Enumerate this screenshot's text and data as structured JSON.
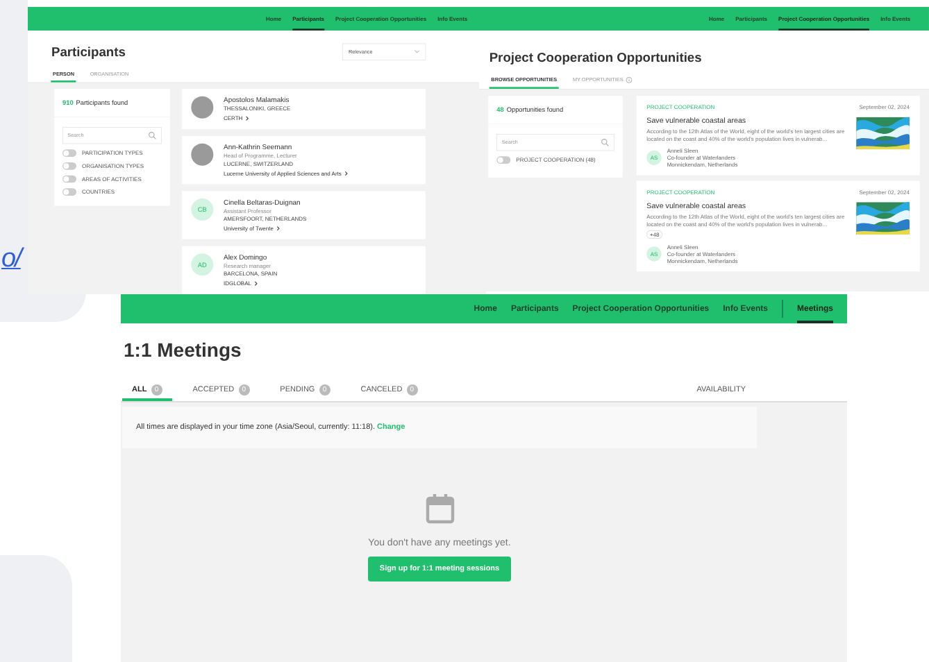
{
  "background_link": "o/",
  "participants_window": {
    "nav": [
      {
        "label": "Home",
        "selected": false
      },
      {
        "label": "Participants",
        "selected": true
      },
      {
        "label": "Project Cooperation Opportunities",
        "selected": false
      },
      {
        "label": "Info Events",
        "selected": false
      }
    ],
    "title": "Participants",
    "sort": "Relevance",
    "tabs": [
      {
        "label": "PERSON",
        "selected": true
      },
      {
        "label": "ORGANISATION",
        "selected": false
      }
    ],
    "found_count": "910",
    "found_label": "Participants found",
    "search": {
      "placeholder": "Search"
    },
    "filters": [
      {
        "label": "PARTICIPATION TYPES",
        "on": false
      },
      {
        "label": "ORGANISATION TYPES",
        "on": false
      },
      {
        "label": "AREAS OF ACTIVITIES",
        "on": false
      },
      {
        "label": "COUNTRIES",
        "on": false
      }
    ],
    "people": [
      {
        "kind": "photo",
        "name": "Apostolos Malamakis",
        "location": "THESSALONIKI, GREECE",
        "organisation": "CERTH"
      },
      {
        "kind": "photo",
        "name": "Ann-Kathrin Seemann",
        "role": "Head of Programme, Lecturer",
        "location": "LUCERNE, SWITZERLAND",
        "organisation": "Lucerne University of Applied Sciences and Arts"
      },
      {
        "kind": "initials",
        "initials": "CB",
        "name": "Cinella Beltaras-Duignan",
        "role": "Assistant Professor",
        "location": "AMERSFOORT, NETHERLANDS",
        "organisation": "University of Twente"
      },
      {
        "kind": "initials",
        "initials": "AD",
        "name": "Alex Domingo",
        "role": "Research manager",
        "location": "BARCELONA, SPAIN",
        "organisation": "IDGLOBAL"
      }
    ]
  },
  "opportunities_window": {
    "nav": [
      {
        "label": "Home",
        "selected": false
      },
      {
        "label": "Participants",
        "selected": false
      },
      {
        "label": "Project Cooperation Opportunities",
        "selected": true
      },
      {
        "label": "Info Events",
        "selected": false
      }
    ],
    "title": "Project Cooperation Opportunities",
    "tabs": [
      {
        "label": "BROWSE OPPORTUNITIES",
        "selected": true
      },
      {
        "label": "MY OPPORTUNITIES",
        "selected": false,
        "info_icon": true
      }
    ],
    "found_count": "48",
    "found_label": "Opportunities found",
    "search": {
      "placeholder": "Search"
    },
    "filters": [
      {
        "label": "PROJECT COOPERATION (48)",
        "on": false
      }
    ],
    "cards": [
      {
        "category": "PROJECT COOPERATION",
        "date": "September 02, 2024",
        "title": "Save vulnerable coastal areas",
        "description": "According to the 12th Atlas of the World, eight of the world's ten largest cities are located on the coast and 40% of the world's population lives in vulnerab...",
        "author": {
          "initials": "AS",
          "name": "Anneli Sleen",
          "role": "Co-founder at Waterlanders",
          "location": "Monnickendam, Netherlands"
        }
      },
      {
        "category": "PROJECT COOPERATION",
        "date": "September 02, 2024",
        "title": "Save vulnerable coastal areas",
        "description": "According to the 12th Atlas of the World, eight of the world's ten largest cities are located on the coast and 40% of the world's population lives in vulnerab...",
        "tags": [
          "+48"
        ],
        "author": {
          "initials": "AS",
          "name": "Anneli Sleen",
          "role": "Co-founder at Waterlanders",
          "location": "Monnickendam, Netherlands"
        }
      }
    ]
  },
  "meetings_window": {
    "nav": [
      {
        "label": "Home",
        "selected": false
      },
      {
        "label": "Participants",
        "selected": false
      },
      {
        "label": "Project Cooperation Opportunities",
        "selected": false
      },
      {
        "label": "Info Events",
        "selected": false
      },
      {
        "label": "Meetings",
        "selected": true,
        "separated": true
      }
    ],
    "title": "1:1 Meetings",
    "tabs": [
      {
        "label": "ALL",
        "count": "0",
        "selected": true
      },
      {
        "label": "ACCEPTED",
        "count": "0",
        "selected": false
      },
      {
        "label": "PENDING",
        "count": "0",
        "selected": false
      },
      {
        "label": "CANCELED",
        "count": "0",
        "selected": false
      }
    ],
    "availability": "AVAILABILITY",
    "notice": {
      "text": "All times are displayed in your time zone (Asia/Seoul, currently: 11:18).",
      "link": "Change"
    },
    "empty_message": "You don't have any meetings yet.",
    "signup_button": "Sign up for 1:1 meeting sessions"
  }
}
